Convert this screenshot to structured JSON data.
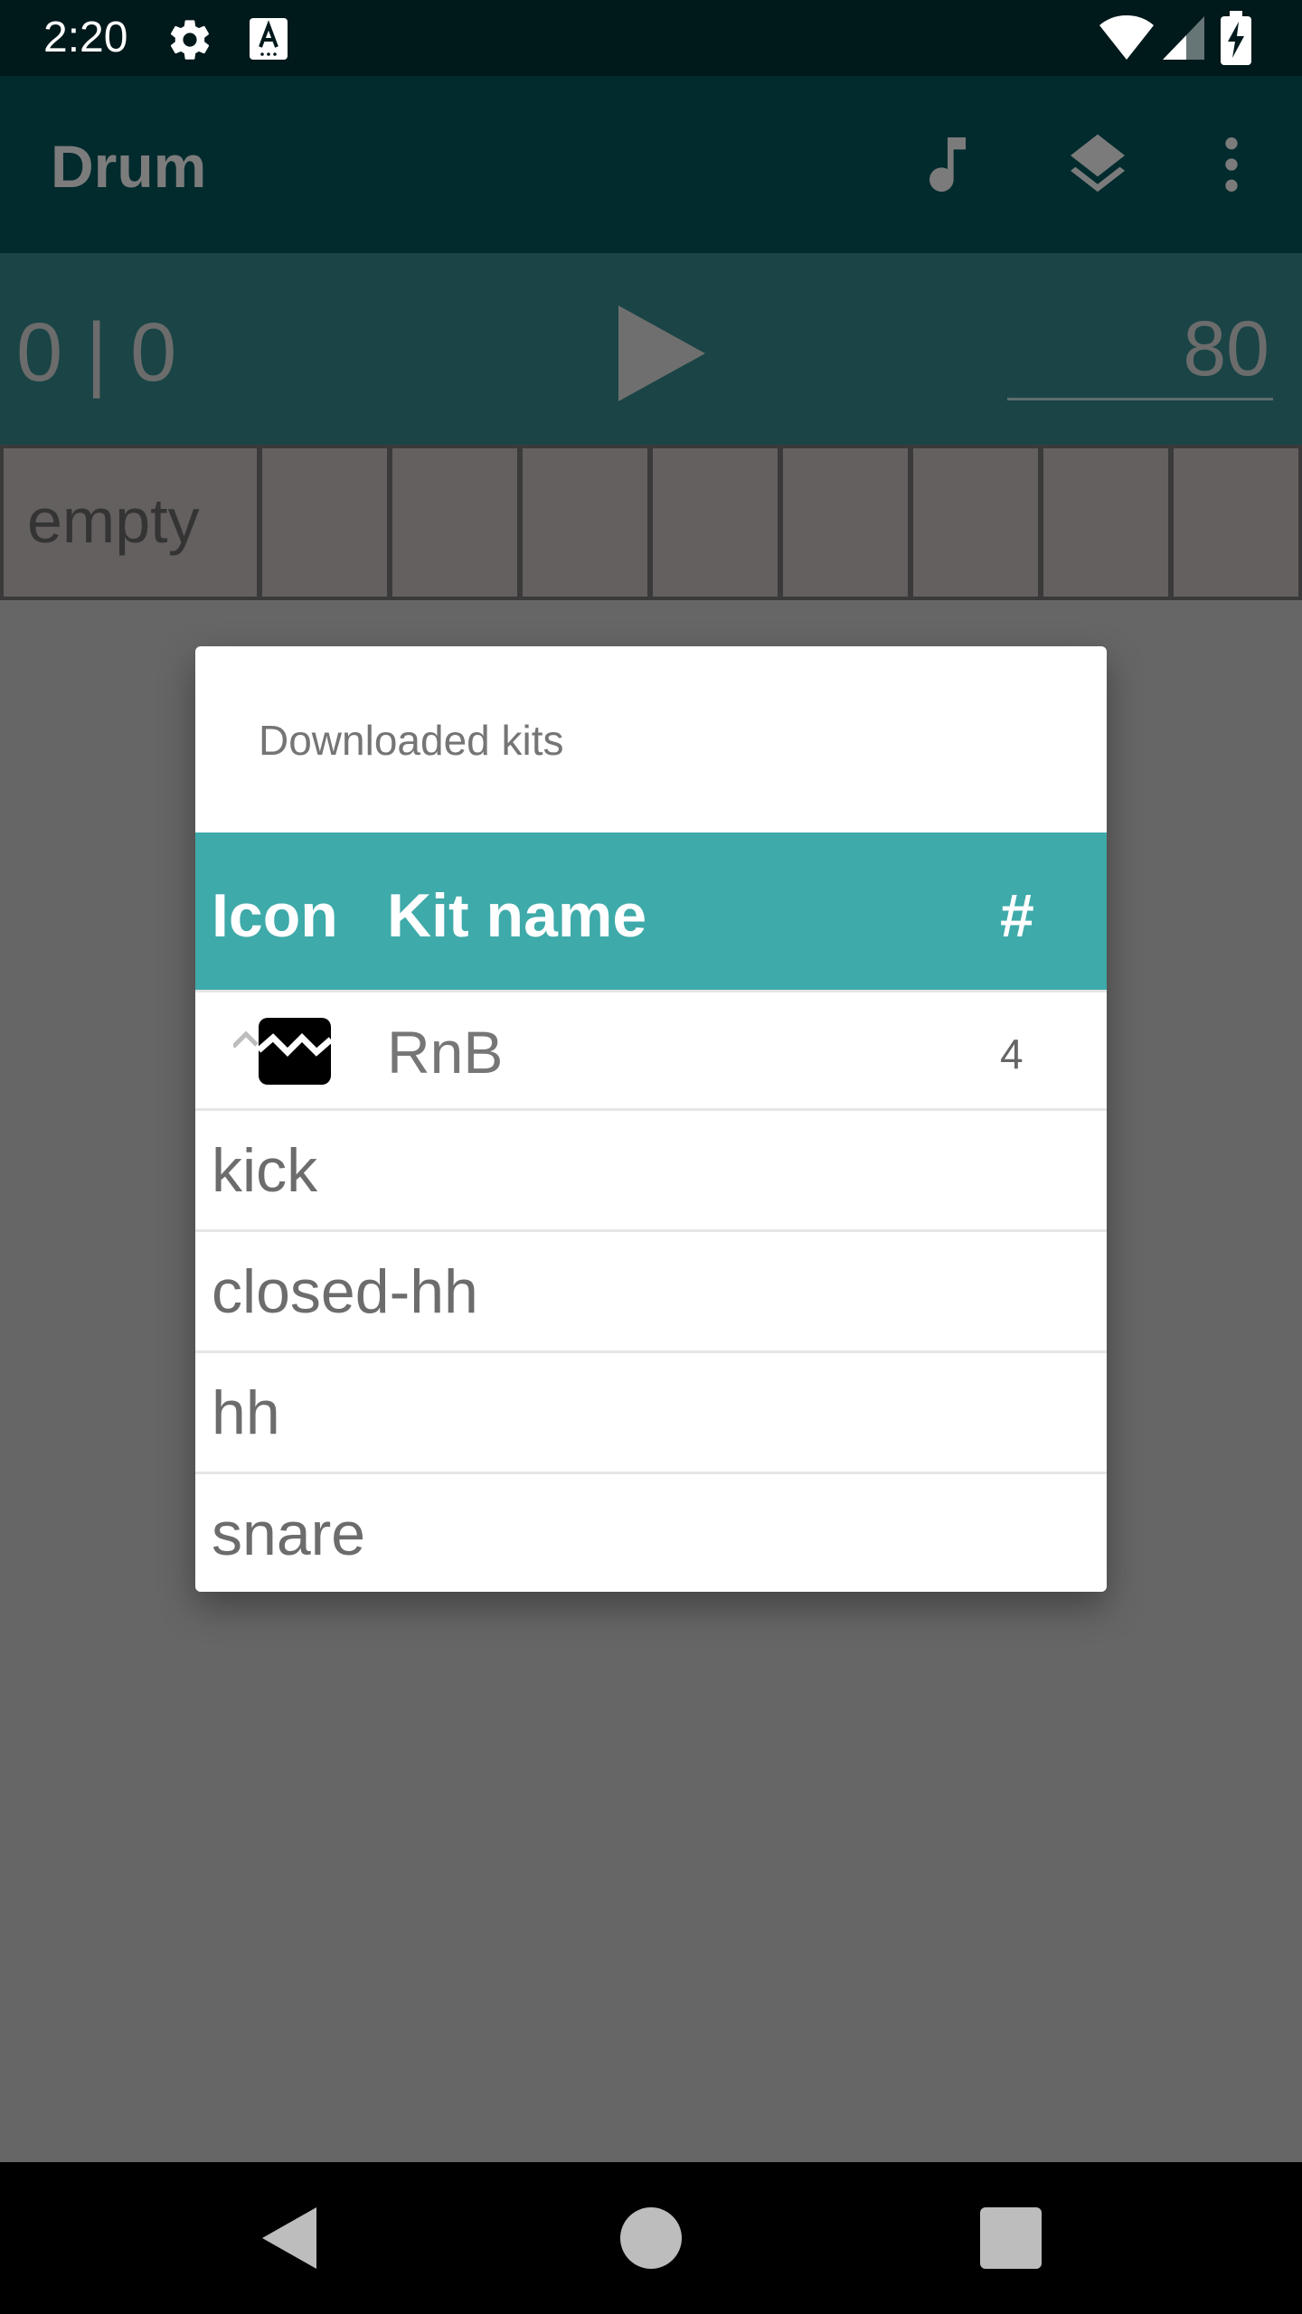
{
  "status_bar": {
    "time": "2:20",
    "icons": [
      "gear-icon",
      "keyboard-a-icon",
      "wifi-icon",
      "signal-icon",
      "battery-charging-icon"
    ]
  },
  "app_bar": {
    "title": "Drum",
    "actions": [
      "music-note-icon",
      "layers-icon",
      "more-vert-icon"
    ]
  },
  "transport": {
    "counter": "0 | 0",
    "tempo": "80"
  },
  "pads": {
    "first_label": "empty",
    "count": 9
  },
  "dialog": {
    "title": "Downloaded kits",
    "headers": {
      "icon": "Icon",
      "name": "Kit name",
      "count": "#"
    },
    "kit": {
      "name": "RnB",
      "count": "4",
      "icon": "broken-image-icon"
    },
    "sounds": [
      "kick",
      "closed-hh",
      "hh",
      "snare"
    ]
  },
  "nav_bar": {
    "buttons": [
      "back-icon",
      "home-icon",
      "recents-icon"
    ]
  },
  "colors": {
    "status_bar": "#00191b",
    "app_bar": "#022b2e",
    "transport": "#1b4446",
    "header_accent": "#3eaaa9",
    "scrim": "#666666"
  }
}
